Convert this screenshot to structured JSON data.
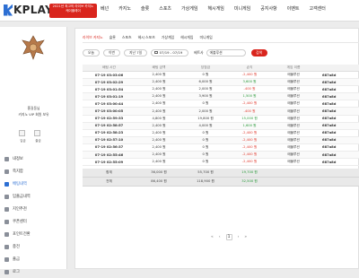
{
  "header": {
    "logo_text": "KPLAY",
    "promo_line1": "2021년 최고의 라이브 카지노",
    "promo_line2": "케이플레이",
    "nav": [
      "베넌",
      "카지노",
      "슬롯",
      "스포츠",
      "가상게임",
      "헤시게임",
      "미니게임",
      "공지사항",
      "이벤트",
      "고객센터"
    ]
  },
  "sidebar": {
    "user_line1": "홍길동님",
    "user_line2": "카지노 VIP 회원 보유",
    "mini_buttons": [
      "입금",
      "출금"
    ],
    "menu": [
      {
        "label": "내정보",
        "active": false
      },
      {
        "label": "쪽지함",
        "active": false
      },
      {
        "label": "배팅내역",
        "active": true
      },
      {
        "label": "입출금내역",
        "active": false
      },
      {
        "label": "지인추천",
        "active": false
      },
      {
        "label": "쿠폰센터",
        "active": false
      },
      {
        "label": "포인트전환",
        "active": false
      },
      {
        "label": "충전",
        "active": false
      },
      {
        "label": "출금",
        "active": false
      },
      {
        "label": "로그",
        "active": false
      }
    ]
  },
  "main": {
    "tabs": [
      {
        "label": "라이브 카지노",
        "active": true
      },
      {
        "label": "슬롯",
        "active": false
      },
      {
        "label": "스포츠",
        "active": false
      },
      {
        "label": "헤시 스포츠",
        "active": false
      },
      {
        "label": "가상게임",
        "active": false
      },
      {
        "label": "헤시게임",
        "active": false
      },
      {
        "label": "미니게임",
        "active": false
      }
    ],
    "filters": {
      "today": "오늘",
      "week": "이번",
      "last7": "지난 7일",
      "date_range": "07/19 - 07/19",
      "game_label": "베트사",
      "game_value": "에볼루션",
      "search": "검색"
    },
    "columns": [
      "배팅 시간",
      "배팅 금액",
      "당첨금",
      "손익",
      "게임 이름",
      ""
    ],
    "rows": [
      [
        "07-19 03:03:06",
        "2,400 원",
        "0 원",
        "-2,400 원",
        "에볼루션",
        "687a8d"
      ],
      [
        "07-19 03:02:29",
        "2,400 원",
        "6,000 원",
        "3,600 원",
        "에볼루션",
        "687a8d"
      ],
      [
        "07-19 03:01:54",
        "2,400 원",
        "2,000 원",
        "-400 원",
        "에볼루션",
        "687a8d"
      ],
      [
        "07-19 03:01:19",
        "2,400 원",
        "3,900 원",
        "1,500 원",
        "에볼루션",
        "687a8d"
      ],
      [
        "07-19 03:00:44",
        "2,400 원",
        "0 원",
        "-2,400 원",
        "에볼루션",
        "687a8d"
      ],
      [
        "07-19 03:00:05",
        "2,400 원",
        "2,000 원",
        "-400 원",
        "에볼루션",
        "687a8d"
      ],
      [
        "07-19 02:59:33",
        "4,800 원",
        "19,800 원",
        "15,000 원",
        "에볼루션",
        "687a8d"
      ],
      [
        "07-19 02:58:57",
        "2,400 원",
        "4,000 원",
        "1,600 원",
        "에볼루션",
        "687a8d"
      ],
      [
        "07-19 02:58:23",
        "2,400 원",
        "0 원",
        "-2,400 원",
        "에볼루션",
        "687a8d"
      ],
      [
        "07-19 02:57:10",
        "2,400 원",
        "0 원",
        "-2,400 원",
        "에볼루션",
        "687a8d"
      ],
      [
        "07-19 02:56:37",
        "2,400 원",
        "0 원",
        "-2,400 원",
        "에볼루션",
        "687a8d"
      ],
      [
        "07-19 02:55:46",
        "2,400 원",
        "0 원",
        "-2,400 원",
        "에볼루션",
        "687a8d"
      ],
      [
        "07-19 02:55:09",
        "2,400 원",
        "0 원",
        "-2,400 원",
        "에볼루션",
        "687a8d"
      ]
    ],
    "summary": [
      [
        "합계",
        "36,000 원",
        "55,700 원",
        "19,700 원",
        "",
        ""
      ],
      [
        "전체",
        "86,400 원",
        "118,900 원",
        "32,500 원",
        "",
        ""
      ]
    ],
    "pager": {
      "first": "«",
      "prev": "‹",
      "current": "1",
      "next": "›",
      "last": "»"
    }
  },
  "colors": {
    "accent": "#d9251d",
    "brand": "#2d6fd3",
    "loss": "#e03a2e",
    "gain": "#2a9a3a"
  },
  "icons": [
    "emblem-icon",
    "calendar-icon",
    "menu-item-icon"
  ]
}
